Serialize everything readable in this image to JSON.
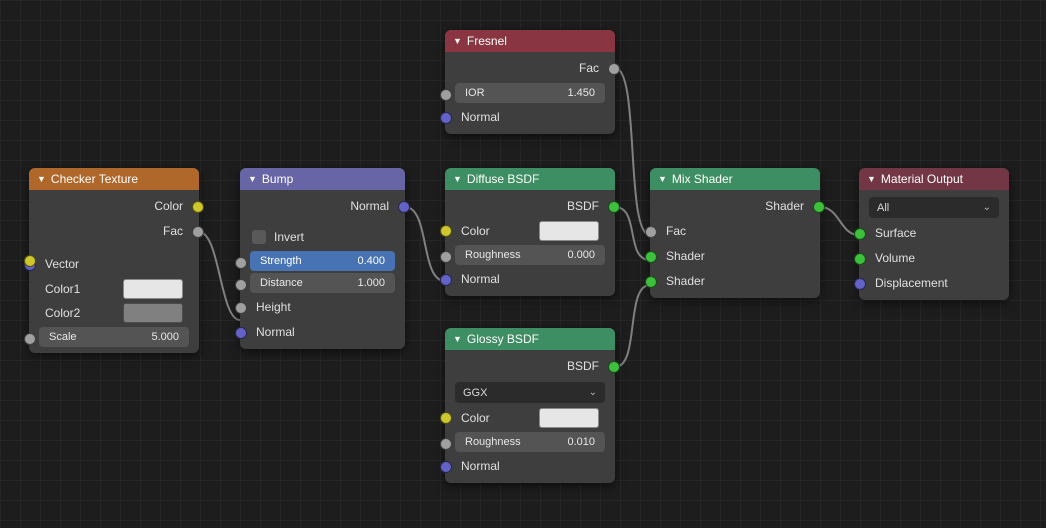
{
  "nodes": {
    "checker": {
      "title": "Checker Texture",
      "out_color": "Color",
      "out_fac": "Fac",
      "in_vector": "Vector",
      "in_color1": "Color1",
      "in_color2": "Color2",
      "scale_label": "Scale",
      "scale_value": "5.000",
      "color1_hex": "#e6e6e6",
      "color2_hex": "#808080"
    },
    "bump": {
      "title": "Bump",
      "out_normal": "Normal",
      "invert": "Invert",
      "strength_label": "Strength",
      "strength_value": "0.400",
      "distance_label": "Distance",
      "distance_value": "1.000",
      "in_height": "Height",
      "in_normal": "Normal"
    },
    "fresnel": {
      "title": "Fresnel",
      "out_fac": "Fac",
      "ior_label": "IOR",
      "ior_value": "1.450",
      "in_normal": "Normal"
    },
    "diffuse": {
      "title": "Diffuse BSDF",
      "out_bsdf": "BSDF",
      "in_color": "Color",
      "color_hex": "#e6e6e6",
      "rough_label": "Roughness",
      "rough_value": "0.000",
      "in_normal": "Normal"
    },
    "glossy": {
      "title": "Glossy BSDF",
      "out_bsdf": "BSDF",
      "dist": "GGX",
      "in_color": "Color",
      "color_hex": "#e6e6e6",
      "rough_label": "Roughness",
      "rough_value": "0.010",
      "in_normal": "Normal"
    },
    "mix": {
      "title": "Mix Shader",
      "out_shader": "Shader",
      "in_fac": "Fac",
      "in_shader1": "Shader",
      "in_shader2": "Shader"
    },
    "output": {
      "title": "Material Output",
      "target": "All",
      "in_surface": "Surface",
      "in_volume": "Volume",
      "in_disp": "Displacement"
    }
  }
}
